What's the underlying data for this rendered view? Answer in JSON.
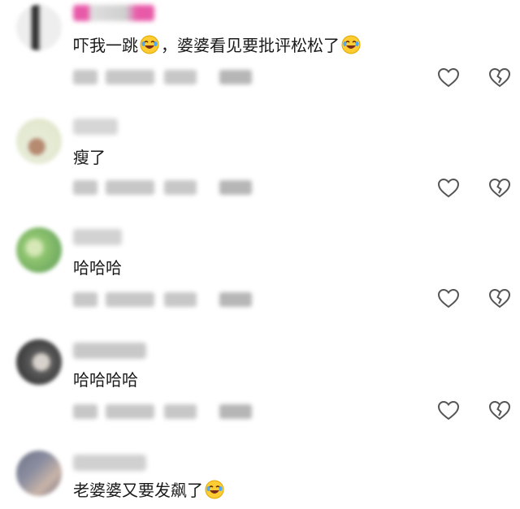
{
  "comments": [
    {
      "text_before": "吓我一跳",
      "text_middle": "，婆婆看见要批评松松了",
      "has_inline_emoji": true,
      "has_trailing_emoji": true,
      "emoji_icon": "laughing-crying-emoji-icon",
      "username_color": "#e85aa8",
      "avatar_colors": [
        "#e8e2d8",
        "#6a5f55"
      ]
    },
    {
      "text_before": "瘦了",
      "text_middle": "",
      "has_inline_emoji": false,
      "has_trailing_emoji": false,
      "username_color": "#cfcfcf",
      "avatar_colors": [
        "#e7ecd8",
        "#b58a70"
      ]
    },
    {
      "text_before": "哈哈哈",
      "text_middle": "",
      "has_inline_emoji": false,
      "has_trailing_emoji": false,
      "username_color": "#cfcfcf",
      "avatar_colors": [
        "#a9d48f",
        "#5f9c5a"
      ]
    },
    {
      "text_before": "哈哈哈哈",
      "text_middle": "",
      "has_inline_emoji": false,
      "has_trailing_emoji": false,
      "username_color": "#c2c2c2",
      "avatar_colors": [
        "#2b2b2b",
        "#d8d2cc"
      ]
    },
    {
      "text_before": "老婆婆又要发飙了",
      "text_middle": "",
      "has_inline_emoji": false,
      "has_trailing_emoji": true,
      "emoji_icon": "laughing-crying-emoji-icon",
      "username_color": "#c9c9c9",
      "avatar_colors": [
        "#6e7386",
        "#c8b4a8"
      ]
    }
  ],
  "icons": {
    "like": "heart-outline-icon",
    "dislike": "broken-heart-icon"
  },
  "colors": {
    "text": "#1a1a1a",
    "icon_stroke": "#555555",
    "meta_blur": "#c7c7c7"
  }
}
